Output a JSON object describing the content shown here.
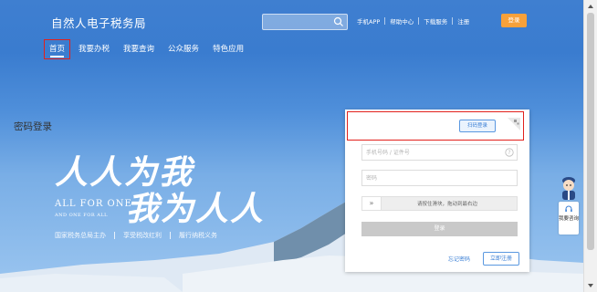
{
  "header": {
    "brand": "自然人电子税务局",
    "search": {
      "placeholder": ""
    },
    "top_links": [
      "手机APP",
      "帮助中心",
      "下载服务",
      "注册"
    ],
    "login_button": "登录"
  },
  "nav": {
    "items": [
      "首页",
      "我要办税",
      "我要查询",
      "公众服务",
      "特色应用"
    ],
    "active": "首页"
  },
  "hero": {
    "slogan_line1": "人人为我",
    "slogan_line2": "我为人人",
    "english_main": "ALL FOR ONE",
    "english_sub": "AND ONE FOR ALL",
    "tagline": [
      "国家税务总局主办",
      "享受税改红利",
      "履行纳税义务"
    ]
  },
  "login_panel": {
    "title": "密码登录",
    "qr_button": "扫码登录",
    "account_placeholder": "手机号码 / 证件号",
    "password_placeholder": "密码",
    "slider_handle": "»",
    "slider_hint": "请按住滑块，拖动到最右边",
    "submit": "登录",
    "forgot": "忘记密码",
    "register": "立即注册"
  },
  "side_service": {
    "label": "我要咨询"
  },
  "colors": {
    "accent_orange": "#f7a13a",
    "link_blue": "#3a7fd5",
    "highlight_red": "#e2211c"
  }
}
